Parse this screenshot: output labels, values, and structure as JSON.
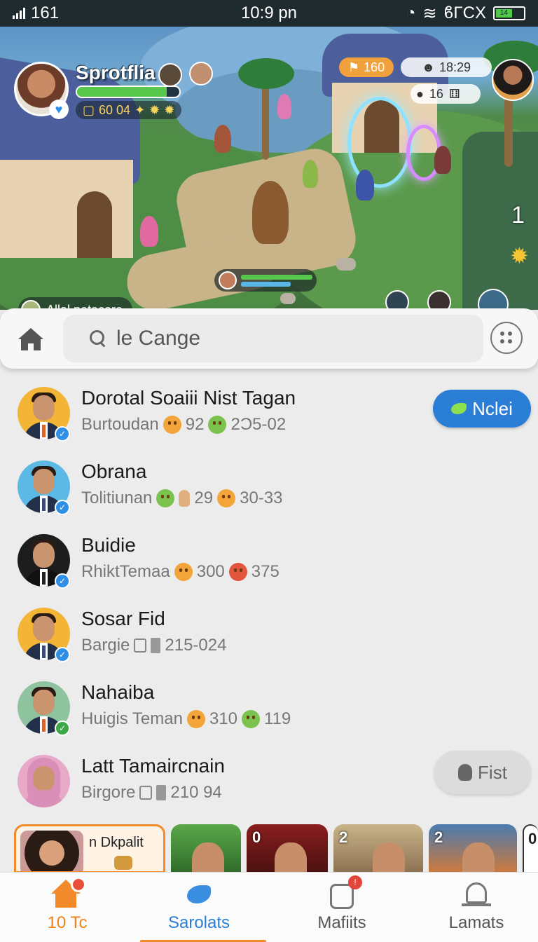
{
  "status_bar": {
    "signal": "161",
    "time": "10:9 pn",
    "right_text": "ϐΓCX",
    "battery_label": "14"
  },
  "game": {
    "profile_name": "Sprotflia",
    "profile_stats": "60 04",
    "resource_amount": "160",
    "timer": "18:29",
    "small_counter": "16",
    "chat_chip": "Allal netacore",
    "side_icon": "1",
    "colors": {
      "health": "#57c84b",
      "mana": "#5bb6e8",
      "accent": "#f0a13c"
    }
  },
  "search": {
    "placeholder": "le Cange",
    "home_icon": "home-icon",
    "more_icon": "more-dots-icon"
  },
  "friends": [
    {
      "name": "Dorotal Soaiii Nist Tagan",
      "sub_label": "Burtoudan",
      "stat1": "92",
      "stat2": "2Ͻ5-02",
      "action": "Nclei",
      "verified": "blue",
      "bg": "#f4b537"
    },
    {
      "name": "Obrana",
      "sub_label": "Tolitiunan",
      "stat1": "29",
      "stat2": "30-33",
      "action": "",
      "verified": "blue",
      "bg": "#5cb8e4"
    },
    {
      "name": "Buidie",
      "sub_label": "RhiktTemaa",
      "stat1": "300",
      "stat2": "375",
      "action": "",
      "verified": "blue",
      "bg": "#1d1d1d"
    },
    {
      "name": "Sosar Fid",
      "sub_label": "Bargie",
      "stat1": "",
      "stat2": "215-024",
      "action": "",
      "verified": "blue",
      "bg": "#f4b537"
    },
    {
      "name": "Nahaiba",
      "sub_label": "Huigis Teman",
      "stat1": "310",
      "stat2": "119",
      "action": "",
      "verified": "green",
      "bg": "#8fc3a0"
    },
    {
      "name": "Latt Tamaircnain",
      "sub_label": "Birgore",
      "stat1": "",
      "stat2": "210 94",
      "action": "Fist",
      "verified": "",
      "bg": "#e8a8c8"
    }
  ],
  "stories": [
    {
      "label": "n Dkpalit",
      "num": ""
    },
    {
      "label": "",
      "num": ""
    },
    {
      "label": "",
      "num": "0"
    },
    {
      "label": "",
      "num": "2"
    },
    {
      "label": "",
      "num": "2"
    },
    {
      "label": "",
      "num": "0"
    }
  ],
  "nav": {
    "home": "10 Tc",
    "social": "Sarolats",
    "messages": "Mafiits",
    "more": "Lamats",
    "messages_badge": "!"
  }
}
